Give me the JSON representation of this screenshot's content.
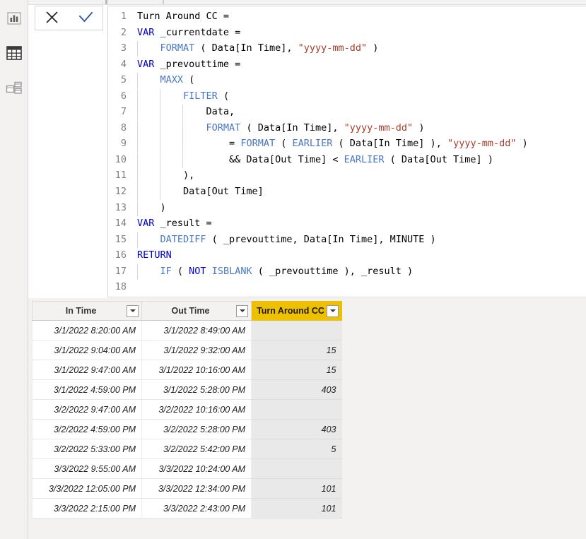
{
  "rail": {
    "items": [
      {
        "name": "report-view",
        "icon": "bar-chart-icon",
        "title": "Report view",
        "selected": false
      },
      {
        "name": "data-view",
        "icon": "table-grid-icon",
        "title": "Data view",
        "selected": true
      },
      {
        "name": "model-view",
        "icon": "model-icon",
        "title": "Model view",
        "selected": false
      }
    ]
  },
  "formula_actions": {
    "cancel_label": "✕",
    "cancel_title": "Cancel",
    "commit_label": "✓",
    "commit_title": "Commit",
    "cancel_color": "#23262b",
    "commit_color": "#2a5699"
  },
  "formula": {
    "measure_name": "Turn Around CC",
    "total_lines": 18,
    "lines": [
      {
        "n": "1",
        "guides": 0,
        "tokens": [
          {
            "t": "Turn Around CC =",
            "c": "pl"
          }
        ]
      },
      {
        "n": "2",
        "guides": 0,
        "tokens": [
          {
            "t": "VAR",
            "c": "kw"
          },
          {
            "t": " _currentdate =",
            "c": "pl"
          }
        ]
      },
      {
        "n": "3",
        "guides": 1,
        "tokens": [
          {
            "t": "    ",
            "c": "pl"
          },
          {
            "t": "FORMAT",
            "c": "fn"
          },
          {
            "t": " ( Data[In Time], ",
            "c": "pl"
          },
          {
            "t": "\"yyyy-mm-dd\"",
            "c": "str"
          },
          {
            "t": " )",
            "c": "pl"
          }
        ]
      },
      {
        "n": "4",
        "guides": 0,
        "tokens": [
          {
            "t": "VAR",
            "c": "kw"
          },
          {
            "t": " _prevouttime =",
            "c": "pl"
          }
        ]
      },
      {
        "n": "5",
        "guides": 1,
        "tokens": [
          {
            "t": "    ",
            "c": "pl"
          },
          {
            "t": "MAXX",
            "c": "fn"
          },
          {
            "t": " (",
            "c": "pl"
          }
        ]
      },
      {
        "n": "6",
        "guides": 2,
        "tokens": [
          {
            "t": "        ",
            "c": "pl"
          },
          {
            "t": "FILTER",
            "c": "fn"
          },
          {
            "t": " (",
            "c": "pl"
          }
        ]
      },
      {
        "n": "7",
        "guides": 3,
        "tokens": [
          {
            "t": "            Data,",
            "c": "pl"
          }
        ]
      },
      {
        "n": "8",
        "guides": 3,
        "tokens": [
          {
            "t": "            ",
            "c": "pl"
          },
          {
            "t": "FORMAT",
            "c": "fn"
          },
          {
            "t": " ( Data[In Time], ",
            "c": "pl"
          },
          {
            "t": "\"yyyy-mm-dd\"",
            "c": "str"
          },
          {
            "t": " )",
            "c": "pl"
          }
        ]
      },
      {
        "n": "9",
        "guides": 3,
        "tokens": [
          {
            "t": "                = ",
            "c": "pl"
          },
          {
            "t": "FORMAT",
            "c": "fn"
          },
          {
            "t": " ( ",
            "c": "pl"
          },
          {
            "t": "EARLIER",
            "c": "fn"
          },
          {
            "t": " ( Data[In Time] ), ",
            "c": "pl"
          },
          {
            "t": "\"yyyy-mm-dd\"",
            "c": "str"
          },
          {
            "t": " )",
            "c": "pl"
          }
        ]
      },
      {
        "n": "10",
        "guides": 3,
        "tokens": [
          {
            "t": "                && Data[Out Time] < ",
            "c": "pl"
          },
          {
            "t": "EARLIER",
            "c": "fn"
          },
          {
            "t": " ( Data[Out Time] )",
            "c": "pl"
          }
        ]
      },
      {
        "n": "11",
        "guides": 2,
        "tokens": [
          {
            "t": "        ),",
            "c": "pl"
          }
        ]
      },
      {
        "n": "12",
        "guides": 2,
        "tokens": [
          {
            "t": "        Data[Out Time]",
            "c": "pl"
          }
        ]
      },
      {
        "n": "13",
        "guides": 1,
        "tokens": [
          {
            "t": "    )",
            "c": "pl"
          }
        ]
      },
      {
        "n": "14",
        "guides": 0,
        "tokens": [
          {
            "t": "VAR",
            "c": "kw"
          },
          {
            "t": " _result =",
            "c": "pl"
          }
        ]
      },
      {
        "n": "15",
        "guides": 1,
        "tokens": [
          {
            "t": "    ",
            "c": "pl"
          },
          {
            "t": "DATEDIFF",
            "c": "fn"
          },
          {
            "t": " ( _prevouttime, Data[In Time], MINUTE )",
            "c": "pl"
          }
        ]
      },
      {
        "n": "16",
        "guides": 0,
        "tokens": [
          {
            "t": "RETURN",
            "c": "kw"
          }
        ]
      },
      {
        "n": "17",
        "guides": 1,
        "tokens": [
          {
            "t": "    ",
            "c": "pl"
          },
          {
            "t": "IF",
            "c": "fn"
          },
          {
            "t": " ( ",
            "c": "pl"
          },
          {
            "t": "NOT",
            "c": "kw"
          },
          {
            "t": " ",
            "c": "pl"
          },
          {
            "t": "ISBLANK",
            "c": "fn"
          },
          {
            "t": " ( _prevouttime ), _result )",
            "c": "pl"
          }
        ]
      },
      {
        "n": "18",
        "guides": 0,
        "tokens": [
          {
            "t": "",
            "c": "pl"
          }
        ]
      }
    ]
  },
  "grid": {
    "selected_column": "Turn Around CC",
    "selected_header_color": "#edc001",
    "filter_icon": "chevron-down-icon",
    "columns": [
      {
        "key": "in_time",
        "label": "In Time"
      },
      {
        "key": "out_time",
        "label": "Out Time"
      },
      {
        "key": "turn_around_cc",
        "label": "Turn Around CC",
        "selected": true
      }
    ],
    "rows": [
      {
        "in_time": "3/1/2022 8:20:00 AM",
        "out_time": "3/1/2022 8:49:00 AM",
        "turn_around_cc": ""
      },
      {
        "in_time": "3/1/2022 9:04:00 AM",
        "out_time": "3/1/2022 9:32:00 AM",
        "turn_around_cc": "15"
      },
      {
        "in_time": "3/1/2022 9:47:00 AM",
        "out_time": "3/1/2022 10:16:00 AM",
        "turn_around_cc": "15"
      },
      {
        "in_time": "3/1/2022 4:59:00 PM",
        "out_time": "3/1/2022 5:28:00 PM",
        "turn_around_cc": "403"
      },
      {
        "in_time": "3/2/2022 9:47:00 AM",
        "out_time": "3/2/2022 10:16:00 AM",
        "turn_around_cc": ""
      },
      {
        "in_time": "3/2/2022 4:59:00 PM",
        "out_time": "3/2/2022 5:28:00 PM",
        "turn_around_cc": "403"
      },
      {
        "in_time": "3/2/2022 5:33:00 PM",
        "out_time": "3/2/2022 5:42:00 PM",
        "turn_around_cc": "5"
      },
      {
        "in_time": "3/3/2022 9:55:00 AM",
        "out_time": "3/3/2022 10:24:00 AM",
        "turn_around_cc": ""
      },
      {
        "in_time": "3/3/2022 12:05:00 PM",
        "out_time": "3/3/2022 12:34:00 PM",
        "turn_around_cc": "101"
      },
      {
        "in_time": "3/3/2022 2:15:00 PM",
        "out_time": "3/3/2022 2:43:00 PM",
        "turn_around_cc": "101"
      }
    ]
  }
}
